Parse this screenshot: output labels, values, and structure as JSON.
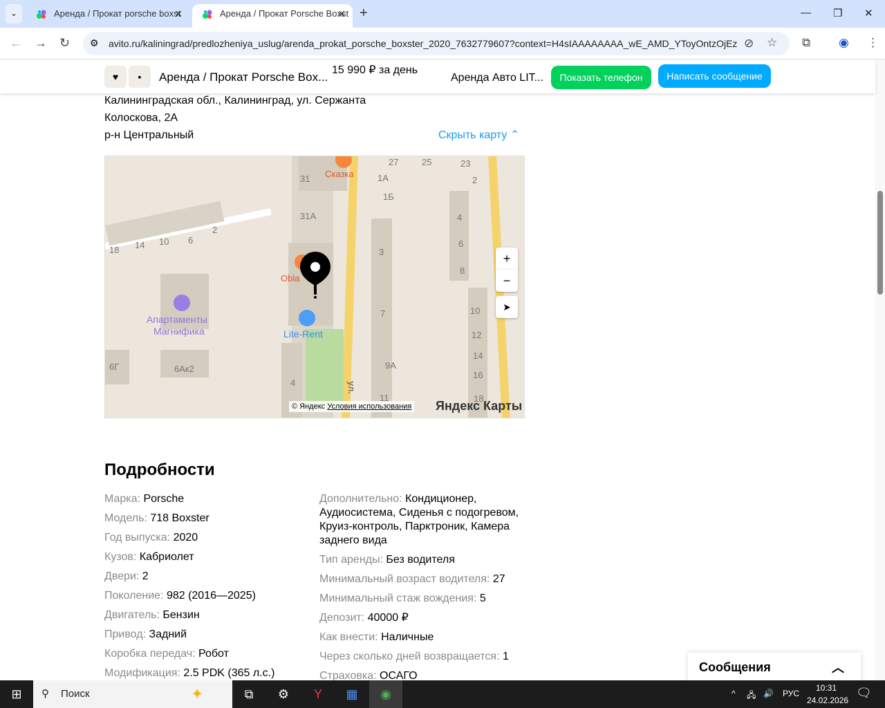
{
  "browser": {
    "tabs": [
      {
        "title": "Аренда / Прокат porsche boxst"
      },
      {
        "title": "Аренда / Прокат Porsche Boxst"
      }
    ],
    "url": "avito.ru/kaliningrad/predlozheniya_uslug/arenda_prokat_porsche_boxster_2020_7632779607?context=H4sIAAAAAAAA_wE_AMD_YToyOntzOjEzOi..."
  },
  "sticky": {
    "title": "Аренда / Прокат Porsche Box...",
    "price": "15 990 ₽ за день",
    "seller": "Аренда Авто LIT...",
    "show_phone": "Показать телефон",
    "write_message": "Написать сообщение",
    "colors": {
      "green": "#02d15c",
      "blue": "#00aaff"
    }
  },
  "address": {
    "line1": "Калининградская обл., Калининград, ул. Сержанта",
    "line2": "Колоскова, 2А",
    "district": "р-н Центральный",
    "hide_map": "Скрыть карту ⌃"
  },
  "map": {
    "labels": [
      "31",
      "Сказка",
      "27",
      "25",
      "23",
      "1А",
      "2",
      "1Б",
      "31А",
      "4",
      "6",
      "8",
      "2",
      "18",
      "14",
      "10",
      "6",
      "3",
      "Obla",
      "Апартаменты",
      "Магнифика",
      "Lite-Rent",
      "7",
      "10",
      "12",
      "14",
      "16",
      "9А",
      "6Г",
      "6Ак2",
      "4",
      "11",
      "18",
      "ул."
    ],
    "copyright": "© Яндекс",
    "terms": "Условия использования",
    "logo": "Яндекс Карты",
    "zoom_in": "+",
    "zoom_out": "−"
  },
  "details": {
    "title": "Подробности",
    "left": [
      {
        "k": "Марка:",
        "v": "Porsche"
      },
      {
        "k": "Модель:",
        "v": "718 Boxster"
      },
      {
        "k": "Год выпуска:",
        "v": "2020"
      },
      {
        "k": "Кузов:",
        "v": "Кабриолет"
      },
      {
        "k": "Двери:",
        "v": "2"
      },
      {
        "k": "Поколение:",
        "v": "982 (2016—2025)"
      },
      {
        "k": "Двигатель:",
        "v": "Бензин"
      },
      {
        "k": "Привод:",
        "v": "Задний"
      },
      {
        "k": "Коробка передач:",
        "v": "Робот"
      },
      {
        "k": "Модификация:",
        "v": "2.5 PDK (365 л.с.)"
      }
    ],
    "right": [
      {
        "k": "Дополнительно:",
        "v": "Кондиционер, Аудиосистема, Сиденья с подогревом, Круиз-контроль, Парктроник, Камера заднего вида"
      },
      {
        "k": "Тип аренды:",
        "v": "Без водителя"
      },
      {
        "k": "Минимальный возраст водителя:",
        "v": "27"
      },
      {
        "k": "Минимальный стаж вождения:",
        "v": "5"
      },
      {
        "k": "Депозит:",
        "v": "40000 ₽"
      },
      {
        "k": "Как внести:",
        "v": "Наличные"
      },
      {
        "k": "Через сколько дней возвращается:",
        "v": "1"
      },
      {
        "k": "Страховка:",
        "v": "ОСАГО"
      }
    ]
  },
  "messages": {
    "label": "Сообщения"
  },
  "taskbar": {
    "search": "Поиск",
    "lang": "РУС",
    "time": "10:31",
    "date": "24.02.2026"
  }
}
